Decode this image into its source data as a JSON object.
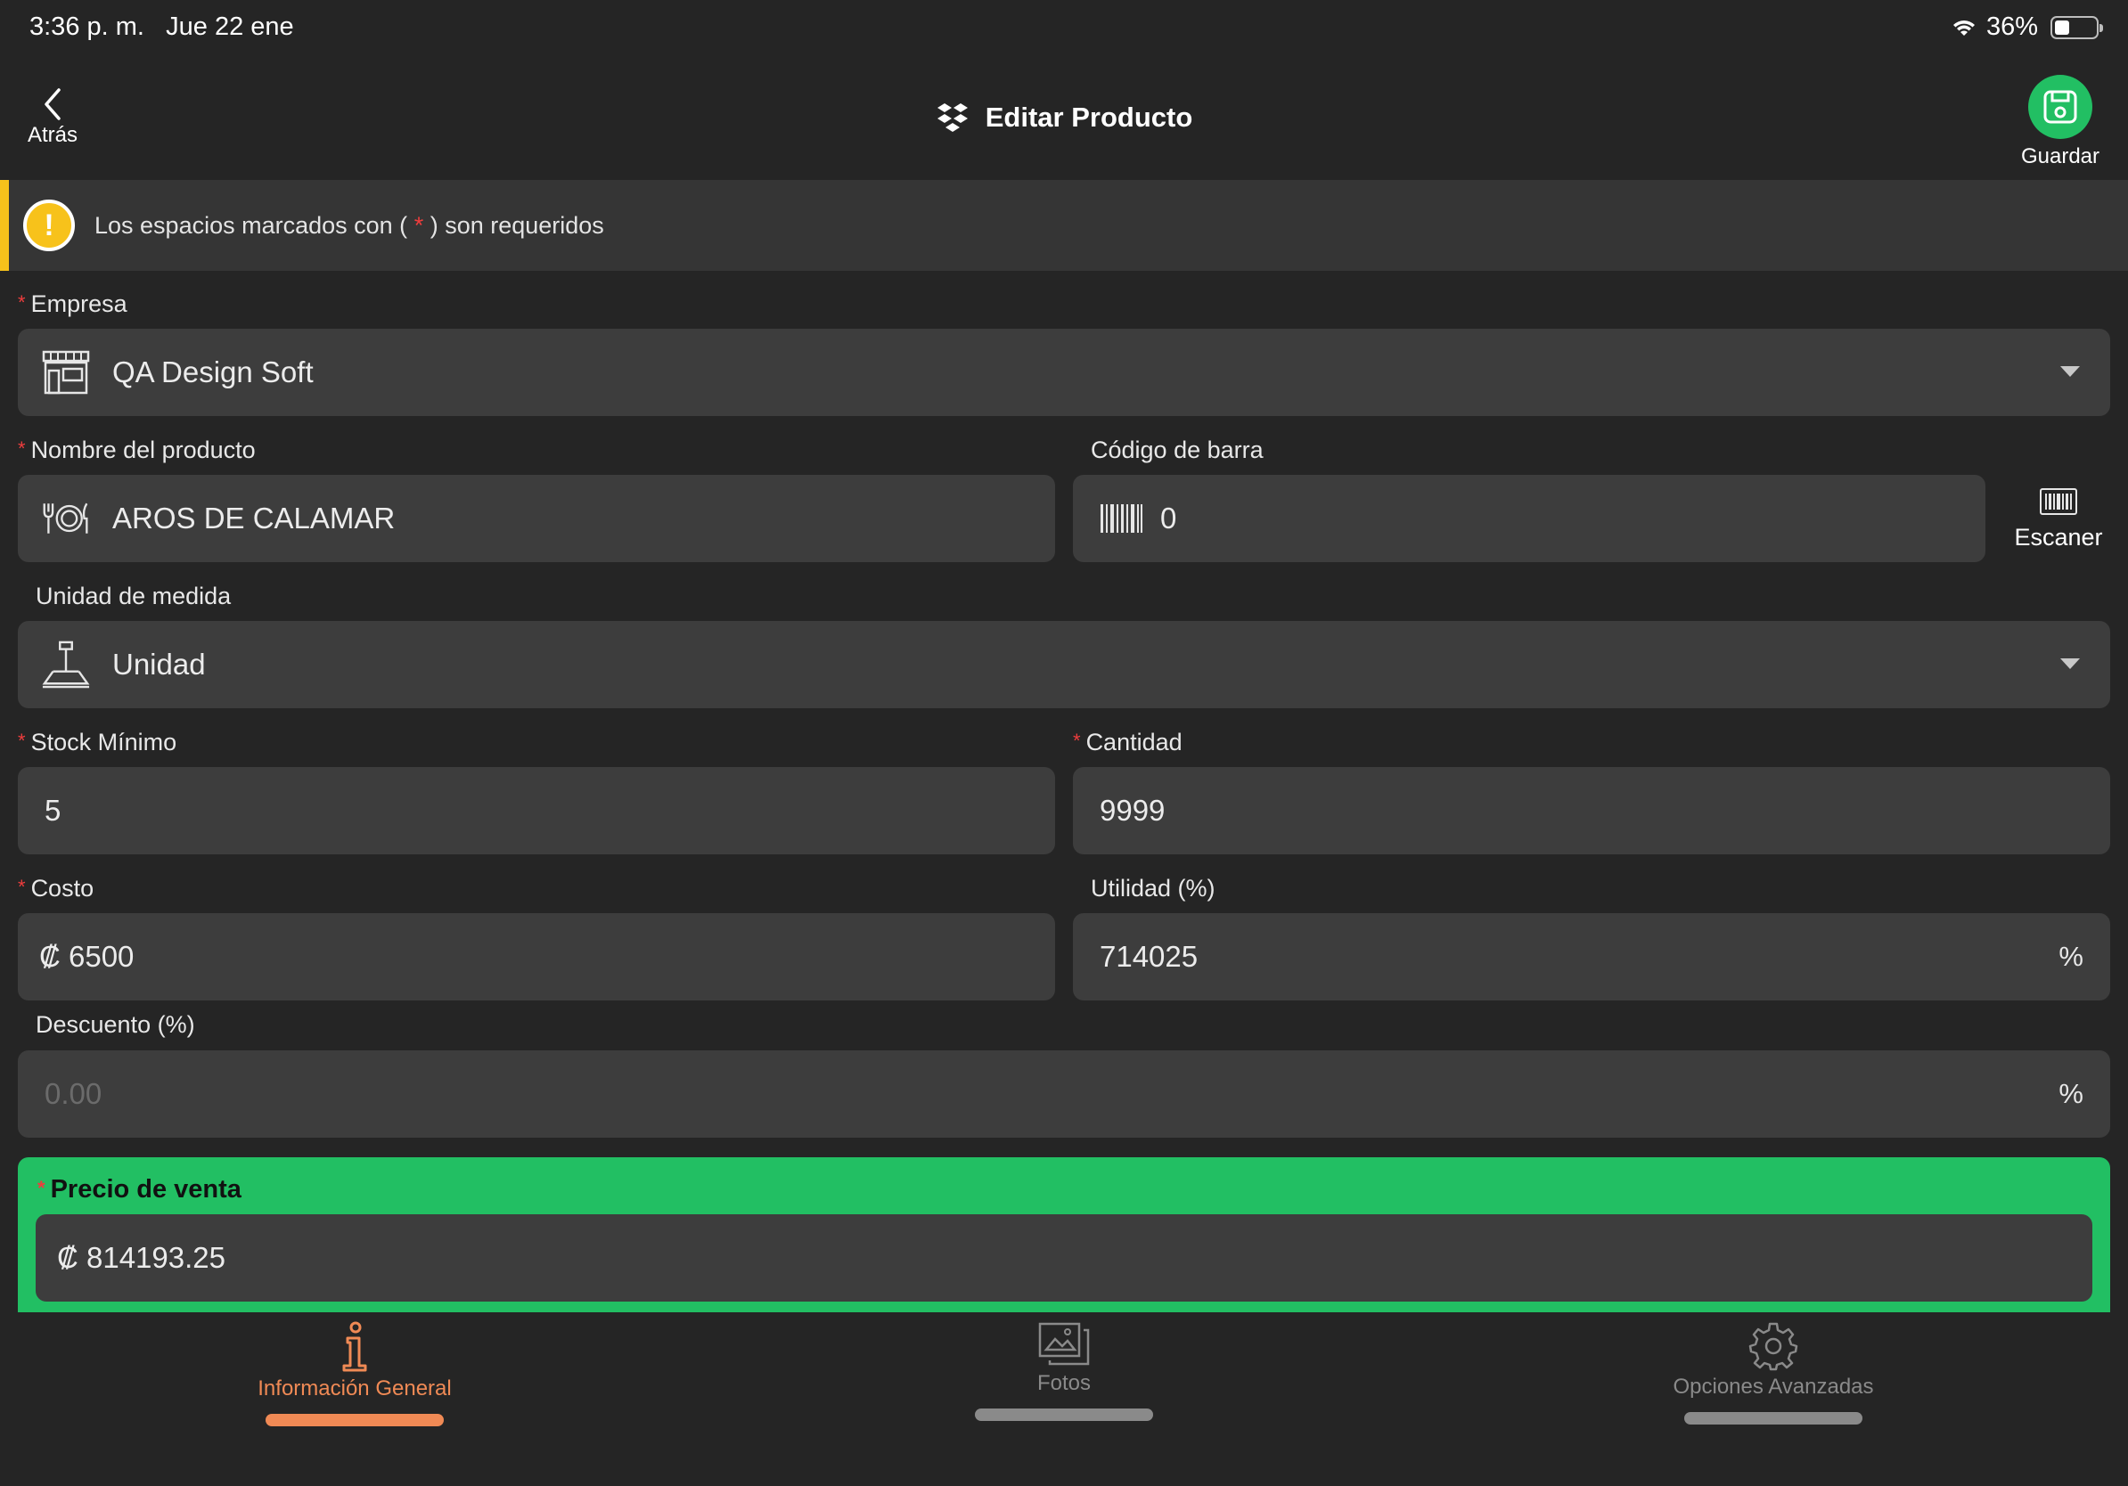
{
  "status_bar": {
    "time": "3:36 p. m.",
    "date": "Jue 22 ene",
    "battery": "36%",
    "battery_level": 0.36
  },
  "nav": {
    "back_label": "Atrás",
    "title": "Editar Producto",
    "save_label": "Guardar"
  },
  "alert": {
    "text_before": "Los espacios marcados con ( ",
    "star": "*",
    "text_after": " ) son requeridos"
  },
  "form": {
    "required_star": "*",
    "empresa": {
      "label": "Empresa",
      "value": "QA Design Soft",
      "icon": "store-icon"
    },
    "nombre": {
      "label": "Nombre del producto",
      "value": "AROS DE CALAMAR",
      "icon": "dining-icon"
    },
    "codigo": {
      "label": "Código de barra",
      "value": "0",
      "icon": "barcode-icon"
    },
    "scanner_label": "Escaner",
    "unidad": {
      "label": "Unidad de medida",
      "value": "Unidad",
      "icon": "scale-icon"
    },
    "stock_minimo": {
      "label": "Stock Mínimo",
      "value": "5"
    },
    "cantidad": {
      "label": "Cantidad",
      "value": "9999"
    },
    "costo": {
      "label": "Costo",
      "value": "₡ 6500"
    },
    "utilidad": {
      "label": "Utilidad (%)",
      "value": "714025",
      "suffix": "%"
    },
    "descuento": {
      "label": "Descuento (%)",
      "placeholder": "0.00",
      "suffix": "%"
    },
    "precio": {
      "label": "Precio de venta",
      "value": "₡ 814193.25"
    }
  },
  "tabs": [
    {
      "label": "Información General",
      "icon": "info-icon",
      "active": true
    },
    {
      "label": "Fotos",
      "icon": "photos-icon",
      "active": false
    },
    {
      "label": "Opciones Avanzadas",
      "icon": "gear-icon",
      "active": false
    }
  ],
  "colors": {
    "background": "#252525",
    "field": "#3d3d3d",
    "accent_green": "#22bf63",
    "warning_yellow": "#f7c21b",
    "required_red": "#ef3d3d",
    "active_tab": "#f08a55",
    "inactive_tab": "#8a8a8a"
  }
}
